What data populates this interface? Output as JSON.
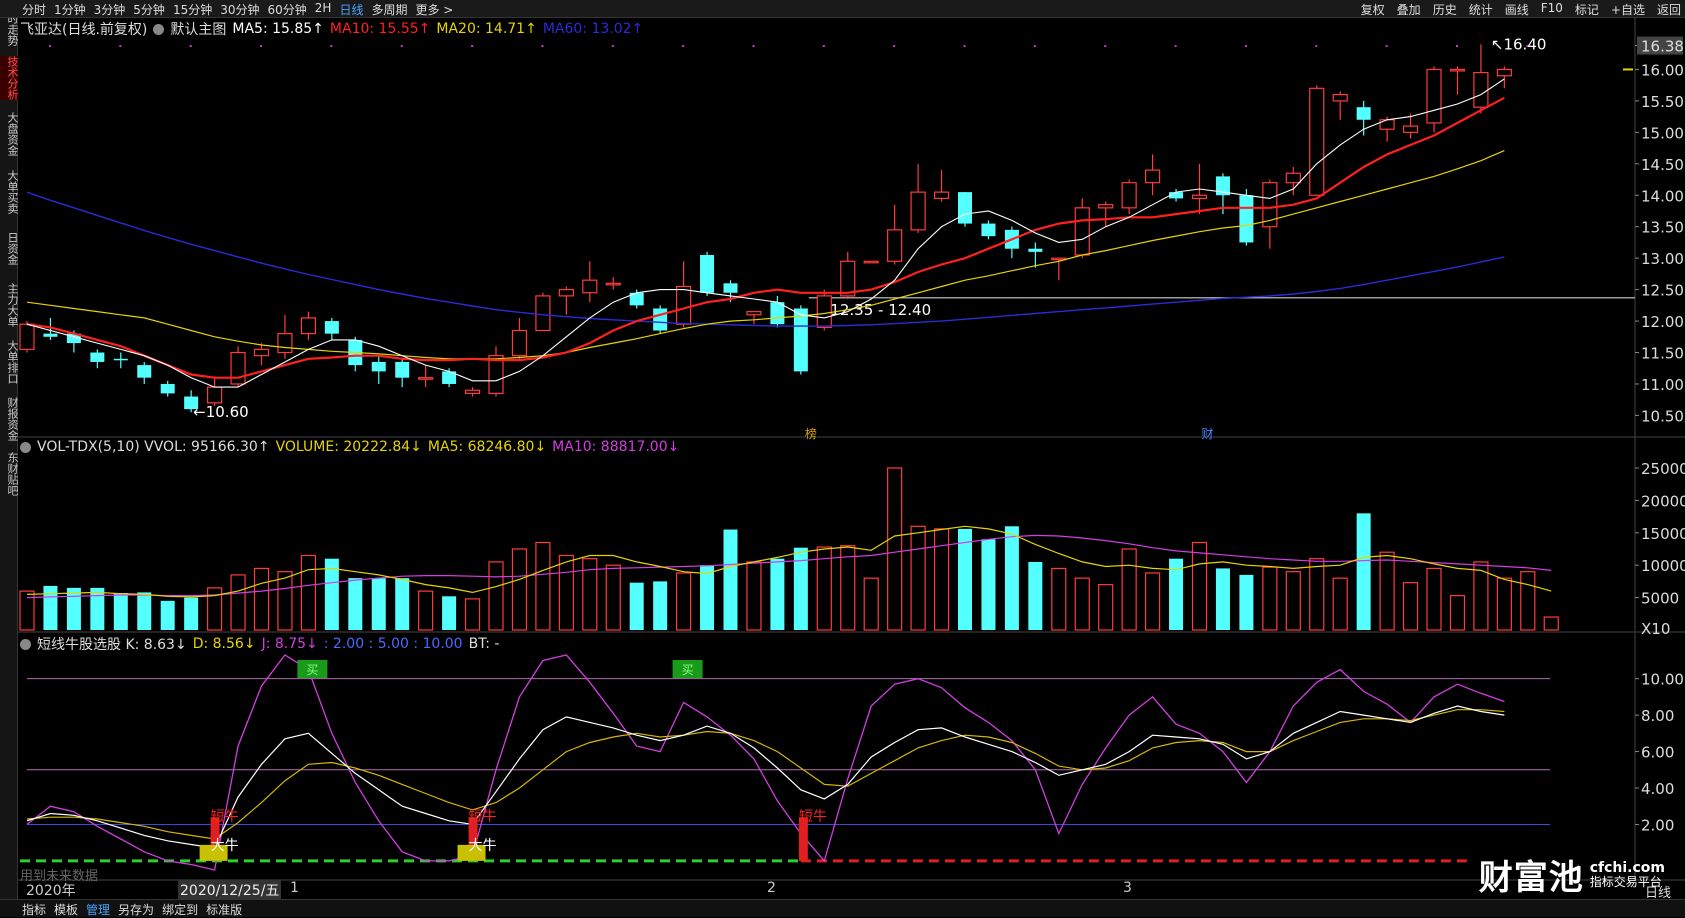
{
  "toolbar": {
    "left_items": [
      "分时",
      "1分钟",
      "3分钟",
      "5分钟",
      "15分钟",
      "30分钟",
      "60分钟",
      "2H",
      "日线",
      "多周期",
      "更多 >"
    ],
    "active_index": 8,
    "right_items": [
      "复权",
      "叠加",
      "历史",
      "统计",
      "画线",
      "F10",
      "标记",
      "+自选",
      "返回"
    ]
  },
  "sidebar": {
    "items": [
      "分时走势",
      "技术分析",
      "大盘资金",
      "大单买卖",
      "日资金",
      "主力大单",
      "大单排口",
      "财报资金",
      "东财贴吧"
    ],
    "active_index": 1
  },
  "main_legend": {
    "stock": "飞亚达(日线.前复权)",
    "template": "默认主图",
    "ma5": "MA5: 15.85↑",
    "ma10": "MA10: 15.55↑",
    "ma20": "MA20: 14.71↑",
    "ma60": "MA60: 13.02↑"
  },
  "vol_legend": {
    "name": "VOL-TDX(5,10) VVOL: 95166.30↑",
    "volume": "VOLUME: 20222.84↓",
    "ma5": "MA5: 68246.80↓",
    "ma10": "MA10: 88817.00↓"
  },
  "kdj_legend": {
    "name": "短线牛股选股 K: 8.63↓",
    "d": "D: 8.56↓",
    "j": "J: 8.75↓",
    "levels": ": 2.00 : 5.00 : 10.00",
    "bt": "BT: -"
  },
  "price_axis": [
    "16.38",
    "16.00",
    "15.50",
    "15.00",
    "14.50",
    "14.00",
    "13.50",
    "13.00",
    "12.50",
    "12.00",
    "11.50",
    "11.00",
    "10.50"
  ],
  "vol_axis": [
    "25000",
    "20000",
    "15000",
    "10000",
    "5000",
    "X10"
  ],
  "kdj_axis": [
    "10.00",
    "8.00",
    "6.00",
    "4.00",
    "2.00"
  ],
  "annotations": {
    "high": "16.40",
    "low": "10.60",
    "range": "12.35 - 12.40",
    "mark_bang": "榜",
    "mark_cai": "财",
    "short_bull": "短牛",
    "big_bull": "大牛",
    "buy_tag": "买"
  },
  "date_bar": {
    "year": "2020年",
    "cursor_date": "2020/12/25/五",
    "months": [
      "1",
      "2",
      "3"
    ],
    "future_note": "用到未来数据",
    "period": "日线"
  },
  "bottom_tabs": [
    "指标",
    "模板",
    "管理",
    "另存为",
    "绑定到",
    "标准版"
  ],
  "bottom_active_index": 2,
  "watermark": {
    "name": "财富池",
    "site": "cfchi.com",
    "tagline": "指标交易平台"
  },
  "colors": {
    "up": "#ff3b3b",
    "down": "#54ffff",
    "ma5": "#ffffff",
    "ma10": "#ff2020",
    "ma20": "#e6d400",
    "ma60": "#2b2bd6",
    "k": "#ffffff",
    "d": "#d4b800",
    "j": "#d23fe0"
  },
  "chart_data": {
    "type": "candlestick",
    "price_range": [
      10.3,
      16.5
    ],
    "candles": [
      {
        "o": 11.55,
        "c": 11.95,
        "h": 12.0,
        "l": 11.5
      },
      {
        "o": 11.8,
        "c": 11.75,
        "h": 12.05,
        "l": 11.7
      },
      {
        "o": 11.8,
        "c": 11.65,
        "h": 11.85,
        "l": 11.5
      },
      {
        "o": 11.5,
        "c": 11.35,
        "h": 11.55,
        "l": 11.25
      },
      {
        "o": 11.4,
        "c": 11.38,
        "h": 11.5,
        "l": 11.25
      },
      {
        "o": 11.3,
        "c": 11.1,
        "h": 11.35,
        "l": 11.0
      },
      {
        "o": 11.0,
        "c": 10.85,
        "h": 11.05,
        "l": 10.8
      },
      {
        "o": 10.8,
        "c": 10.6,
        "h": 10.9,
        "l": 10.55
      },
      {
        "o": 10.7,
        "c": 10.95,
        "h": 11.1,
        "l": 10.65
      },
      {
        "o": 11.0,
        "c": 11.5,
        "h": 11.6,
        "l": 10.95
      },
      {
        "o": 11.45,
        "c": 11.55,
        "h": 11.65,
        "l": 11.3
      },
      {
        "o": 11.5,
        "c": 11.8,
        "h": 12.1,
        "l": 11.4
      },
      {
        "o": 11.8,
        "c": 12.05,
        "h": 12.15,
        "l": 11.7
      },
      {
        "o": 12.0,
        "c": 11.8,
        "h": 12.05,
        "l": 11.7
      },
      {
        "o": 11.7,
        "c": 11.3,
        "h": 11.75,
        "l": 11.2
      },
      {
        "o": 11.35,
        "c": 11.2,
        "h": 11.45,
        "l": 11.0
      },
      {
        "o": 11.35,
        "c": 11.1,
        "h": 11.4,
        "l": 10.95
      },
      {
        "o": 11.1,
        "c": 11.1,
        "h": 11.3,
        "l": 10.95
      },
      {
        "o": 11.2,
        "c": 11.0,
        "h": 11.25,
        "l": 10.95
      },
      {
        "o": 10.85,
        "c": 10.9,
        "h": 10.95,
        "l": 10.8
      },
      {
        "o": 10.85,
        "c": 11.45,
        "h": 11.6,
        "l": 10.8
      },
      {
        "o": 11.45,
        "c": 11.85,
        "h": 12.05,
        "l": 11.4
      },
      {
        "o": 11.85,
        "c": 12.4,
        "h": 12.45,
        "l": 11.85
      },
      {
        "o": 12.4,
        "c": 12.5,
        "h": 12.55,
        "l": 12.1
      },
      {
        "o": 12.45,
        "c": 12.65,
        "h": 12.95,
        "l": 12.3
      },
      {
        "o": 12.6,
        "c": 12.6,
        "h": 12.7,
        "l": 12.5
      },
      {
        "o": 12.45,
        "c": 12.25,
        "h": 12.5,
        "l": 12.2
      },
      {
        "o": 12.2,
        "c": 11.85,
        "h": 12.25,
        "l": 11.8
      },
      {
        "o": 11.95,
        "c": 12.55,
        "h": 12.95,
        "l": 11.9
      },
      {
        "o": 13.05,
        "c": 12.45,
        "h": 13.1,
        "l": 12.4
      },
      {
        "o": 12.6,
        "c": 12.45,
        "h": 12.65,
        "l": 12.3
      },
      {
        "o": 12.1,
        "c": 12.15,
        "h": 12.15,
        "l": 11.95
      },
      {
        "o": 12.3,
        "c": 11.95,
        "h": 12.4,
        "l": 11.9
      },
      {
        "o": 12.2,
        "c": 11.2,
        "h": 12.25,
        "l": 11.15
      },
      {
        "o": 11.9,
        "c": 12.4,
        "h": 12.5,
        "l": 11.85
      },
      {
        "o": 12.4,
        "c": 12.95,
        "h": 13.1,
        "l": 12.35
      },
      {
        "o": 12.95,
        "c": 12.95,
        "h": 12.95,
        "l": 12.95
      },
      {
        "o": 12.95,
        "c": 13.45,
        "h": 13.85,
        "l": 12.9
      },
      {
        "o": 13.45,
        "c": 14.05,
        "h": 14.5,
        "l": 13.4
      },
      {
        "o": 13.95,
        "c": 14.05,
        "h": 14.4,
        "l": 13.9
      },
      {
        "o": 14.05,
        "c": 13.55,
        "h": 14.05,
        "l": 13.5
      },
      {
        "o": 13.55,
        "c": 13.35,
        "h": 13.6,
        "l": 13.3
      },
      {
        "o": 13.45,
        "c": 13.15,
        "h": 13.5,
        "l": 13.0
      },
      {
        "o": 13.15,
        "c": 13.1,
        "h": 13.25,
        "l": 12.85
      },
      {
        "o": 13.0,
        "c": 13.0,
        "h": 13.0,
        "l": 12.65
      },
      {
        "o": 13.05,
        "c": 13.8,
        "h": 13.95,
        "l": 13.0
      },
      {
        "o": 13.8,
        "c": 13.85,
        "h": 13.9,
        "l": 13.5
      },
      {
        "o": 13.8,
        "c": 14.2,
        "h": 14.25,
        "l": 13.7
      },
      {
        "o": 14.2,
        "c": 14.4,
        "h": 14.65,
        "l": 14.0
      },
      {
        "o": 14.05,
        "c": 13.95,
        "h": 14.1,
        "l": 13.9
      },
      {
        "o": 13.95,
        "c": 14.0,
        "h": 14.5,
        "l": 13.7
      },
      {
        "o": 14.3,
        "c": 14.0,
        "h": 14.35,
        "l": 13.7
      },
      {
        "o": 14.0,
        "c": 13.25,
        "h": 14.1,
        "l": 13.2
      },
      {
        "o": 13.5,
        "c": 14.2,
        "h": 14.25,
        "l": 13.15
      },
      {
        "o": 14.2,
        "c": 14.35,
        "h": 14.45,
        "l": 14.0
      },
      {
        "o": 14.0,
        "c": 15.7,
        "h": 15.75,
        "l": 14.0
      },
      {
        "o": 15.5,
        "c": 15.6,
        "h": 15.65,
        "l": 15.2
      },
      {
        "o": 15.4,
        "c": 15.2,
        "h": 15.5,
        "l": 14.95
      },
      {
        "o": 15.05,
        "c": 15.2,
        "h": 15.25,
        "l": 14.85
      },
      {
        "o": 15.0,
        "c": 15.1,
        "h": 15.3,
        "l": 14.9
      },
      {
        "o": 15.15,
        "c": 16.0,
        "h": 16.05,
        "l": 15.0
      },
      {
        "o": 16.0,
        "c": 16.0,
        "h": 16.05,
        "l": 15.6
      },
      {
        "o": 15.4,
        "c": 15.95,
        "h": 16.4,
        "l": 15.3
      },
      {
        "o": 15.9,
        "c": 16.0,
        "h": 16.05,
        "l": 15.7
      }
    ],
    "ma5": [
      11.95,
      11.85,
      11.75,
      11.65,
      11.55,
      11.45,
      11.3,
      11.1,
      10.95,
      10.95,
      11.15,
      11.35,
      11.55,
      11.7,
      11.7,
      11.6,
      11.45,
      11.3,
      11.2,
      11.05,
      11.05,
      11.2,
      11.45,
      11.75,
      12.05,
      12.3,
      12.45,
      12.5,
      12.5,
      12.45,
      12.4,
      12.35,
      12.3,
      12.1,
      12.05,
      12.15,
      12.35,
      12.65,
      13.15,
      13.5,
      13.7,
      13.75,
      13.6,
      13.4,
      13.25,
      13.3,
      13.5,
      13.65,
      13.85,
      14.05,
      14.1,
      14.05,
      14.0,
      13.95,
      14.1,
      14.5,
      14.8,
      15.05,
      15.2,
      15.25,
      15.35,
      15.45,
      15.6,
      15.85
    ],
    "ma10": [
      11.95,
      11.9,
      11.8,
      11.7,
      11.6,
      11.45,
      11.3,
      11.15,
      11.1,
      11.1,
      11.2,
      11.3,
      11.4,
      11.42,
      11.45,
      11.45,
      11.4,
      11.38,
      11.38,
      11.4,
      11.38,
      11.38,
      11.42,
      11.5,
      11.65,
      11.85,
      12.0,
      12.1,
      12.2,
      12.3,
      12.35,
      12.45,
      12.5,
      12.45,
      12.45,
      12.45,
      12.5,
      12.62,
      12.78,
      12.9,
      13.0,
      13.15,
      13.3,
      13.45,
      13.55,
      13.6,
      13.62,
      13.65,
      13.65,
      13.7,
      13.75,
      13.8,
      13.8,
      13.8,
      13.85,
      13.95,
      14.2,
      14.45,
      14.65,
      14.8,
      14.95,
      15.15,
      15.35,
      15.55
    ],
    "ma20": [
      12.3,
      12.25,
      12.2,
      12.15,
      12.1,
      12.05,
      11.95,
      11.85,
      11.75,
      11.68,
      11.62,
      11.58,
      11.55,
      11.52,
      11.5,
      11.48,
      11.45,
      11.42,
      11.4,
      11.4,
      11.4,
      11.42,
      11.45,
      11.5,
      11.58,
      11.65,
      11.72,
      11.8,
      11.88,
      11.95,
      12.0,
      12.02,
      12.05,
      12.08,
      12.12,
      12.18,
      12.25,
      12.35,
      12.45,
      12.55,
      12.65,
      12.72,
      12.8,
      12.88,
      12.95,
      13.05,
      13.12,
      13.2,
      13.28,
      13.35,
      13.42,
      13.48,
      13.52,
      13.6,
      13.7,
      13.8,
      13.9,
      14.0,
      14.1,
      14.2,
      14.3,
      14.42,
      14.55,
      14.71
    ],
    "ma60": [
      14.05,
      13.92,
      13.8,
      13.68,
      13.56,
      13.44,
      13.33,
      13.22,
      13.12,
      13.02,
      12.92,
      12.83,
      12.74,
      12.66,
      12.58,
      12.5,
      12.43,
      12.36,
      12.3,
      12.24,
      12.18,
      12.14,
      12.1,
      12.07,
      12.04,
      12.02,
      12.0,
      11.98,
      11.96,
      11.95,
      11.94,
      11.93,
      11.92,
      11.92,
      11.92,
      11.93,
      11.94,
      11.96,
      11.98,
      12.0,
      12.03,
      12.06,
      12.09,
      12.12,
      12.15,
      12.18,
      12.21,
      12.24,
      12.27,
      12.3,
      12.33,
      12.36,
      12.38,
      12.4,
      12.43,
      12.47,
      12.52,
      12.58,
      12.65,
      12.72,
      12.79,
      12.86,
      12.94,
      13.02
    ],
    "volume": [
      6000,
      6800,
      6500,
      6500,
      5700,
      5800,
      4500,
      5000,
      6500,
      8500,
      9500,
      9000,
      11500,
      11000,
      8000,
      8000,
      8000,
      6000,
      5200,
      4800,
      10500,
      12500,
      13500,
      11500,
      11000,
      10000,
      7300,
      7500,
      8800,
      10000,
      15500,
      10500,
      11000,
      12700,
      12800,
      13000,
      8000,
      25000,
      16000,
      15600,
      15600,
      14000,
      16000,
      10500,
      9500,
      8000,
      7000,
      12500,
      8800,
      11000,
      13500,
      9500,
      8500,
      9700,
      9000,
      11000,
      8000,
      18000,
      12000,
      7300,
      9500,
      5300,
      10500,
      8000,
      9000,
      2000
    ],
    "vol_ma5": [
      5500,
      5600,
      5700,
      5800,
      5600,
      5500,
      5200,
      5100,
      5300,
      6000,
      7200,
      8000,
      9300,
      9500,
      9000,
      8500,
      7800,
      7000,
      6500,
      5800,
      6700,
      7800,
      9200,
      10500,
      11500,
      11500,
      10500,
      9800,
      9000,
      8700,
      9800,
      10500,
      11200,
      12000,
      12500,
      12800,
      12300,
      14500,
      15000,
      15500,
      16000,
      15600,
      14800,
      13200,
      11800,
      10500,
      9800,
      10000,
      9500,
      9300,
      10200,
      10500,
      10000,
      9800,
      9500,
      9800,
      10000,
      11200,
      11500,
      11000,
      10200,
      9500,
      9200,
      7800,
      7000,
      6000
    ],
    "vol_ma10": [
      5000,
      5100,
      5200,
      5300,
      5400,
      5400,
      5300,
      5300,
      5400,
      5700,
      6000,
      6400,
      6900,
      7300,
      7700,
      8000,
      8300,
      8400,
      8400,
      8300,
      8200,
      8300,
      8600,
      8900,
      9300,
      9500,
      9600,
      9700,
      9800,
      9900,
      10100,
      10300,
      10500,
      10700,
      11000,
      11300,
      11500,
      12000,
      12500,
      13000,
      13500,
      14000,
      14400,
      14600,
      14500,
      14200,
      13800,
      13300,
      12700,
      12200,
      11900,
      11600,
      11300,
      11000,
      10800,
      10600,
      10600,
      10700,
      10800,
      10600,
      10400,
      10200,
      10000,
      9800,
      9600,
      9200
    ],
    "kdj_range": [
      -0.5,
      11.3
    ],
    "k": [
      2.2,
      2.6,
      2.5,
      2.2,
      1.8,
      1.4,
      1.1,
      0.9,
      0.7,
      3.5,
      5.3,
      6.7,
      7.0,
      5.9,
      4.8,
      3.9,
      3.0,
      2.6,
      2.2,
      2.0,
      3.8,
      5.6,
      7.2,
      7.9,
      7.6,
      7.3,
      6.9,
      6.6,
      6.9,
      7.4,
      7.0,
      6.2,
      5.1,
      3.9,
      3.4,
      4.2,
      5.7,
      6.5,
      7.2,
      7.3,
      6.8,
      6.4,
      6.0,
      5.4,
      4.7,
      5.0,
      5.3,
      6.0,
      6.9,
      6.8,
      6.7,
      6.4,
      5.6,
      6.0,
      7.0,
      7.6,
      8.2,
      8.0,
      7.8,
      7.6,
      8.1,
      8.5,
      8.2,
      8.0
    ],
    "d": [
      2.3,
      2.4,
      2.4,
      2.3,
      2.1,
      1.9,
      1.6,
      1.4,
      1.2,
      2.1,
      3.2,
      4.4,
      5.3,
      5.4,
      5.1,
      4.7,
      4.2,
      3.7,
      3.2,
      2.8,
      3.2,
      4.0,
      5.0,
      6.0,
      6.5,
      6.8,
      7.0,
      6.8,
      6.9,
      7.1,
      7.0,
      6.6,
      6.0,
      5.1,
      4.2,
      4.1,
      4.8,
      5.5,
      6.2,
      6.6,
      6.9,
      6.8,
      6.5,
      5.9,
      5.2,
      5.0,
      5.1,
      5.5,
      6.2,
      6.5,
      6.6,
      6.5,
      6.0,
      6.0,
      6.6,
      7.1,
      7.6,
      7.8,
      7.8,
      7.7,
      8.0,
      8.3,
      8.3,
      8.2
    ],
    "j": [
      2.0,
      3.0,
      2.7,
      1.9,
      1.2,
      0.5,
      0.0,
      -0.2,
      -0.5,
      6.3,
      9.6,
      11.3,
      10.5,
      7.0,
      4.3,
      2.2,
      0.5,
      0.0,
      0.0,
      0.3,
      5.0,
      9.0,
      11.0,
      11.3,
      9.8,
      8.1,
      6.3,
      6.0,
      8.7,
      7.9,
      6.9,
      5.6,
      3.3,
      1.5,
      0.0,
      4.5,
      8.5,
      9.7,
      10.0,
      9.5,
      8.4,
      7.6,
      6.6,
      5.0,
      1.5,
      4.2,
      6.2,
      8.0,
      9.0,
      7.5,
      7.0,
      6.0,
      4.3,
      6.0,
      8.5,
      9.8,
      10.5,
      9.3,
      8.6,
      7.6,
      9.0,
      9.7,
      9.2,
      8.75
    ]
  }
}
